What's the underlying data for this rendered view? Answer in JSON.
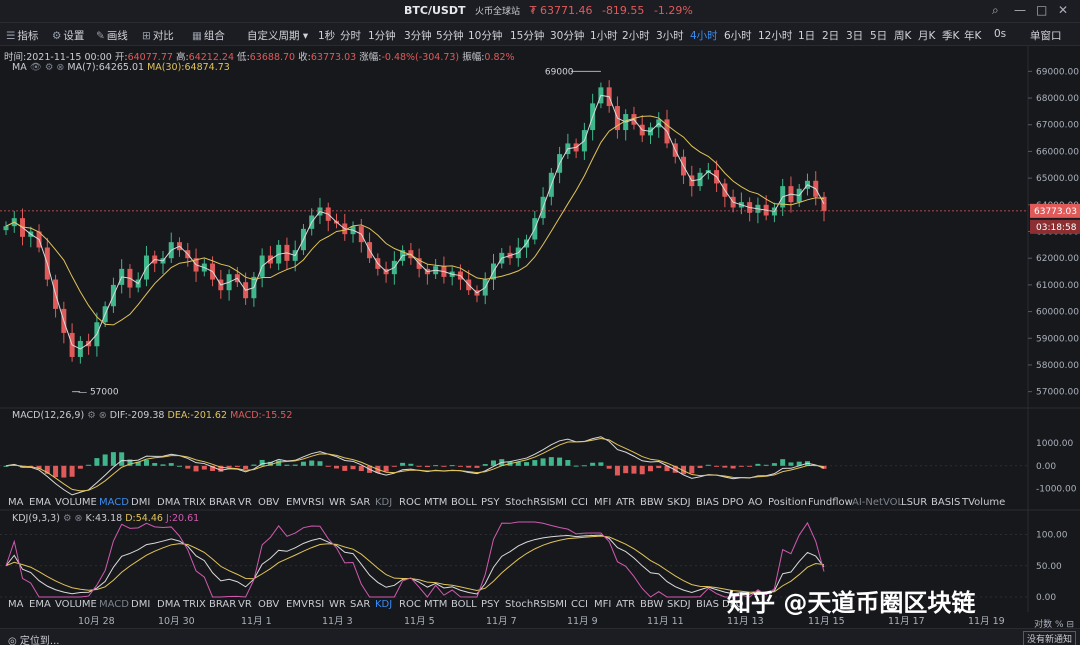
{
  "titlebar": {
    "pair": "BTC/USDT",
    "venue": "火币全球站",
    "price": "₮ 63771.46",
    "change": "-819.55",
    "change_pct": "-1.29%"
  },
  "toolbar": {
    "tools": [
      {
        "icon": "menu-icon",
        "glyph": "☰",
        "label": "指标"
      },
      {
        "icon": "gear-icon",
        "glyph": "⚙",
        "label": "设置"
      },
      {
        "icon": "pencil-icon",
        "glyph": "✎",
        "label": "画线"
      },
      {
        "icon": "compare-icon",
        "glyph": "⊞",
        "label": "对比"
      },
      {
        "icon": "layout-icon",
        "glyph": "▦",
        "label": "组合"
      }
    ],
    "custom_period": "自定义周期",
    "periods": [
      "1秒",
      "分时",
      "1分钟",
      "3分钟",
      "5分钟",
      "10分钟",
      "15分钟",
      "30分钟",
      "1小时",
      "2小时",
      "3小时",
      "4小时",
      "6小时",
      "12小时",
      "1日",
      "2日",
      "3日",
      "5日",
      "周K",
      "月K",
      "季K",
      "年K",
      "0s",
      "单窗口"
    ],
    "active_period": "4小时"
  },
  "ohlc": {
    "time_label": "时间",
    "time": "2021-11-15 00:00",
    "open_label": "开",
    "open": "64077.77",
    "high_label": "高",
    "high": "64212.24",
    "low_label": "低",
    "low": "63688.70",
    "close_label": "收",
    "close": "63773.03",
    "change_label": "涨幅",
    "change": "-0.48%(-304.73)",
    "amp_label": "振幅",
    "amp": "0.82%"
  },
  "ma_legend": {
    "name": "MA",
    "ma7": "MA(7):64265.01",
    "ma30": "MA(30):64874.73"
  },
  "macd_legend": {
    "name": "MACD(12,26,9)",
    "dif": "DIF:-209.38",
    "dea": "DEA:-201.62",
    "macd": "MACD:-15.52"
  },
  "kdj_legend": {
    "name": "KDJ(9,3,3)",
    "k": "K:43.18",
    "d": "D:54.46",
    "j": "J:20.61"
  },
  "indicator_tabs": [
    "MA",
    "EMA",
    "VOLUME",
    "MACD",
    "DMI",
    "DMA",
    "TRIX",
    "BRAR",
    "VR",
    "OBV",
    "EMV",
    "RSI",
    "WR",
    "SAR",
    "KDJ",
    "ROC",
    "MTM",
    "BOLL",
    "PSY",
    "StochRSI",
    "SMI",
    "CCI",
    "MFI",
    "ATR",
    "BBW",
    "SKDJ",
    "BIAS",
    "DPO",
    "AO",
    "Position",
    "Fundflow",
    "AI-NetVOL",
    "LSUR",
    "BASIS",
    "TVolume"
  ],
  "indicator_tabs_2": [
    "MA",
    "EMA",
    "VOLUME",
    "MACD",
    "DMI",
    "DMA",
    "TRIX",
    "BRAR",
    "VR",
    "OBV",
    "EMV",
    "RSI",
    "WR",
    "SAR",
    "KDJ",
    "ROC",
    "MTM",
    "BOLL",
    "PSY",
    "StochRSI",
    "SMI",
    "CCI",
    "MFI",
    "ATR",
    "BBW",
    "SKDJ",
    "BIAS",
    "DPO"
  ],
  "x_axis": [
    "10月 28",
    "10月 30",
    "11月 1",
    "11月 3",
    "11月 5",
    "11月 7",
    "11月 9",
    "11月 11",
    "11月 13",
    "11月 15",
    "11月 17",
    "11月 19"
  ],
  "price_axis": [
    "69000.00",
    "68000.00",
    "67000.00",
    "66000.00",
    "65000.00",
    "64000.00",
    "63000.00",
    "62000.00",
    "61000.00",
    "60000.00",
    "59000.00",
    "58000.00",
    "57000.00"
  ],
  "price_tag": "63773.03",
  "countdown": "03:18:58",
  "high_marker": "69000",
  "low_marker": "57000",
  "macd_axis": [
    "1000.00",
    "0.00",
    "-1000.00"
  ],
  "kdj_axis": [
    "100.00",
    "50.00",
    "0.00"
  ],
  "statusbar": {
    "locate": "定位到...",
    "scale_left": "对数",
    "scale_right": "%",
    "notification": "没有新通知"
  },
  "watermark": "知乎 @天道币圈区块链",
  "colors": {
    "up": "#3fb68b",
    "down": "#e05a5a",
    "ma7": "#d9d9d9",
    "ma30": "#e0c35a",
    "kdj_j": "#d05ab0",
    "accent": "#3b8cf0",
    "background": "#17181c"
  },
  "chart_data": {
    "type": "candlestick",
    "interval": "4h",
    "x_range": [
      "10月 27",
      "11月 20"
    ],
    "ylim": [
      56500,
      69500
    ],
    "closes": [
      63200,
      63500,
      62800,
      63000,
      62400,
      61200,
      60100,
      59200,
      58300,
      58900,
      58700,
      59600,
      60200,
      61000,
      61600,
      60900,
      61200,
      62100,
      61800,
      62000,
      62600,
      62300,
      62000,
      61500,
      61800,
      61200,
      60800,
      61400,
      61100,
      60500,
      61300,
      62100,
      61800,
      62500,
      61900,
      62300,
      63100,
      63600,
      63900,
      63400,
      63300,
      62900,
      63200,
      62600,
      62000,
      61600,
      61400,
      61900,
      62300,
      62000,
      61600,
      61400,
      61700,
      61300,
      61500,
      61200,
      60800,
      60600,
      61200,
      61800,
      62200,
      62000,
      62400,
      62700,
      63500,
      64300,
      65200,
      65900,
      66300,
      66000,
      66800,
      67800,
      68400,
      67700,
      66800,
      67400,
      67000,
      66600,
      66900,
      67200,
      66300,
      65800,
      65100,
      64700,
      65200,
      65300,
      64800,
      64300,
      63900,
      64100,
      63700,
      64000,
      63600,
      63900,
      64700,
      64100,
      64600,
      64900,
      64300,
      63773
    ],
    "series": [
      {
        "name": "MA(7)",
        "value_last": 64265.01
      },
      {
        "name": "MA(30)",
        "value_last": 64874.73
      }
    ],
    "macd": {
      "dif_last": -209.38,
      "dea_last": -201.62,
      "macd_last": -15.52,
      "ylim": [
        -1200,
        1800
      ]
    },
    "kdj": {
      "k_last": 43.18,
      "d_last": 54.46,
      "j_last": 20.61,
      "ylim": [
        0,
        120
      ]
    },
    "annotations": [
      "69000",
      "57000"
    ]
  }
}
